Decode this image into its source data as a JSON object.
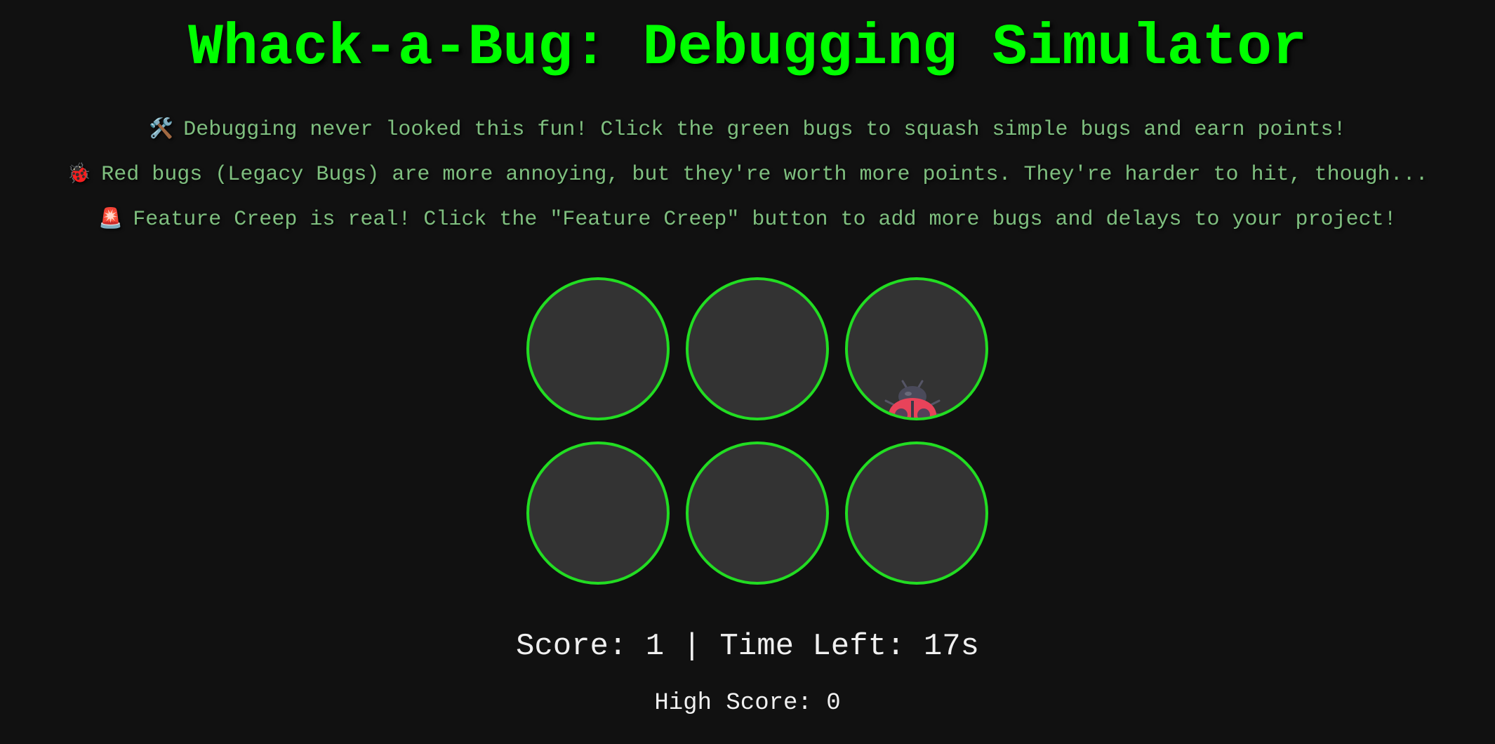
{
  "title": "Whack-a-Bug: Debugging Simulator",
  "instructions": [
    {
      "icon": "🛠️",
      "icon_name": "hammer-wrench-icon",
      "text": "Debugging never looked this fun! Click the green bugs to squash simple bugs and earn points!"
    },
    {
      "icon": "🐞",
      "icon_name": "ladybug-icon",
      "text": "Red bugs (Legacy Bugs) are more annoying, but they're worth more points. They're harder to hit, though..."
    },
    {
      "icon": "🚨",
      "icon_name": "siren-icon",
      "text": "Feature Creep is real! Click the \"Feature Creep\" button to add more bugs and delays to your project!"
    }
  ],
  "holes": [
    {
      "bug": null
    },
    {
      "bug": null
    },
    {
      "bug": "red-ladybug"
    },
    {
      "bug": null
    },
    {
      "bug": null
    },
    {
      "bug": null
    }
  ],
  "status": {
    "score_line": "Score: 1 | Time Left: 17s",
    "score": 1,
    "time_left_seconds": 17,
    "high_score_line": "High Score: 0",
    "high_score": 0
  },
  "colors": {
    "background": "#111111",
    "title": "#00ff00",
    "instruction_text": "#7fbf7f",
    "hole_border": "#22dd22",
    "hole_fill": "#333333",
    "score_text": "#f0f0f0",
    "bug_red": "#e8435a"
  }
}
